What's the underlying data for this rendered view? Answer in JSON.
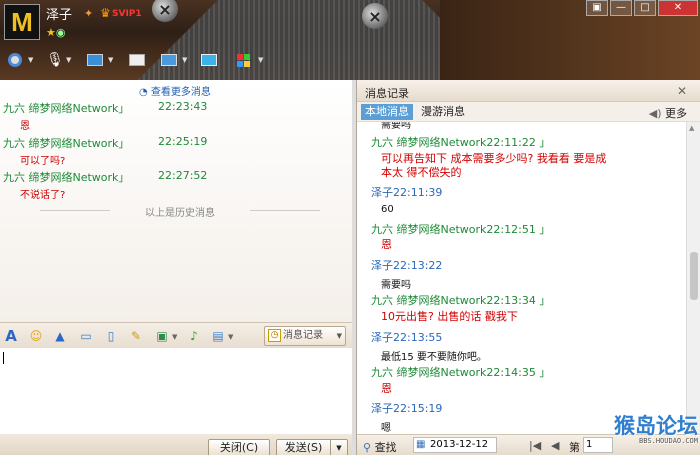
{
  "header": {
    "avatar_glyph": "M",
    "nickname": "泽子",
    "vip_badge": "SVIP1",
    "window_controls": [
      "▣",
      "—",
      "□",
      "✕"
    ]
  },
  "chat": {
    "more_link": "查看更多消息",
    "messages": [
      {
        "sender": "九六  缔梦网络Network」",
        "time": "22:23:43",
        "text": "恩"
      },
      {
        "sender": "九六  缔梦网络Network」",
        "time": "22:25:19",
        "text": "可以了吗?"
      },
      {
        "sender": "九六  缔梦网络Network」",
        "time": "22:27:52",
        "text": "不说话了?"
      }
    ],
    "history_divider": "以上是历史消息"
  },
  "input_toolbar": {
    "history_button": "消息记录"
  },
  "bottom": {
    "close_label": "关闭(C)",
    "send_label": "发送(S)"
  },
  "history_panel": {
    "title": "消息记录",
    "tab_local": "本地消息",
    "tab_roam": "漫游消息",
    "more": "更多",
    "entries": [
      {
        "kind": "me-body",
        "text": "需要吗"
      },
      {
        "kind": "other",
        "head": "九六  缔梦网络Network22:11:22  」"
      },
      {
        "kind": "red",
        "text": "可以再告知下  成本需要多少吗?   我看看    要是成"
      },
      {
        "kind": "red",
        "text": "本太    得不偿失的"
      },
      {
        "kind": "me",
        "head": "泽子22:11:39"
      },
      {
        "kind": "black",
        "text": "60"
      },
      {
        "kind": "other",
        "head": "九六  缔梦网络Network22:12:51  」"
      },
      {
        "kind": "red",
        "text": "恩"
      },
      {
        "kind": "me",
        "head": "泽子22:13:22"
      },
      {
        "kind": "black",
        "text": "需要吗"
      },
      {
        "kind": "other",
        "head": "九六  缔梦网络Network22:13:34  」"
      },
      {
        "kind": "red",
        "text": "10元出售?  出售的话    戳我下"
      },
      {
        "kind": "me",
        "head": "泽子22:13:55"
      },
      {
        "kind": "black",
        "text": "最低15      要不要随你吧。"
      },
      {
        "kind": "other",
        "head": "九六  缔梦网络Network22:14:35  」"
      },
      {
        "kind": "red",
        "text": "恩"
      },
      {
        "kind": "me",
        "head": "泽子22:15:19"
      },
      {
        "kind": "black",
        "text": "嗯"
      }
    ],
    "search_label": "查找",
    "date": "2013-12-12",
    "page_label": "第",
    "page_value": "1"
  },
  "watermark": {
    "main": "猴岛论坛",
    "sub": "BBS.HOUDAO.COM"
  }
}
